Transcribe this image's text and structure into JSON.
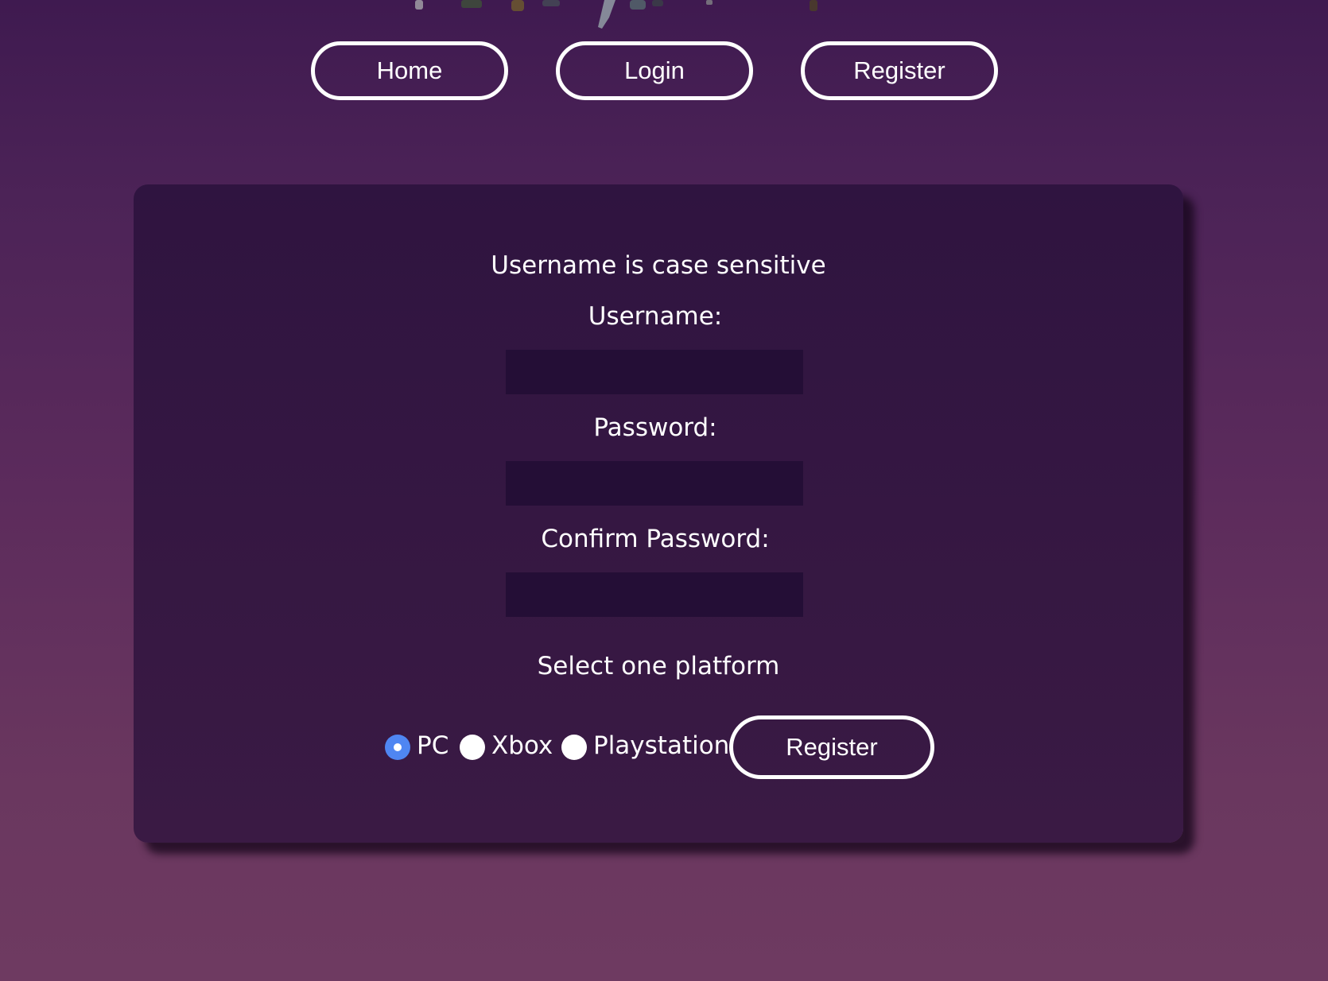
{
  "nav": {
    "home_label": "Home",
    "login_label": "Login",
    "register_label": "Register"
  },
  "form": {
    "hint": "Username is case sensitive",
    "username_label": "Username:",
    "username_value": "",
    "password_label": "Password:",
    "password_value": "",
    "confirm_label": "Confirm Password:",
    "confirm_value": "",
    "platform_prompt": "Select one platform",
    "platforms": [
      {
        "label": "PC",
        "selected": true
      },
      {
        "label": "Xbox",
        "selected": false
      },
      {
        "label": "Playstation",
        "selected": false
      }
    ],
    "submit_label": "Register"
  },
  "colors": {
    "radio_selected": "#4f86f2",
    "input_bg": "#240e36",
    "card_bg": "#351742"
  },
  "icons": {
    "header": "hero-artwork"
  }
}
